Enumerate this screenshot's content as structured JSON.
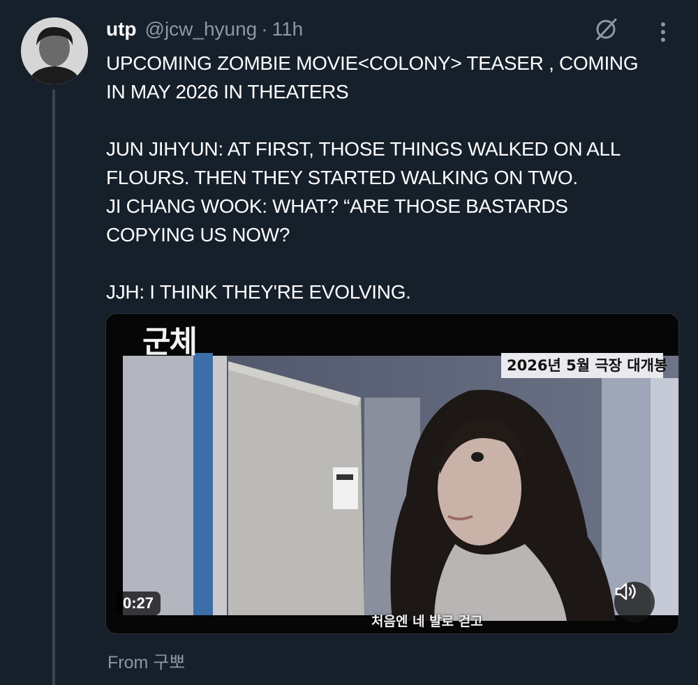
{
  "tweet": {
    "display_name": "utp",
    "handle": "@jcw_hyung",
    "separator": "·",
    "time": "11h",
    "text": "UPCOMING ZOMBIE MOVIE<COLONY> TEASER , COMING\nIN MAY 2026 IN THEATERS\n\nJUN JIHYUN: AT FIRST, THOSE THINGS WALKED ON ALL\nFLOURS. THEN THEY STARTED WALKING ON TWO.\nJI CHANG WOOK: WHAT? “ARE THOSE BASTARDS\nCOPYING US NOW?\n\nJJH: I THINK THEY'RE EVOLVING."
  },
  "icons": {
    "grok": "grok-icon",
    "more": "more-vertical-icon",
    "volume": "volume-icon"
  },
  "media": {
    "title_overlay": "군체",
    "release_overlay": "2026년 5월 극장 대개봉",
    "subtitle": "처음엔 네 발로 걷고",
    "duration": "0:27"
  },
  "footer": {
    "source": "From 구뽀"
  },
  "colors": {
    "background": "#16202b",
    "text": "#ffffff",
    "muted": "#8b98a5"
  }
}
